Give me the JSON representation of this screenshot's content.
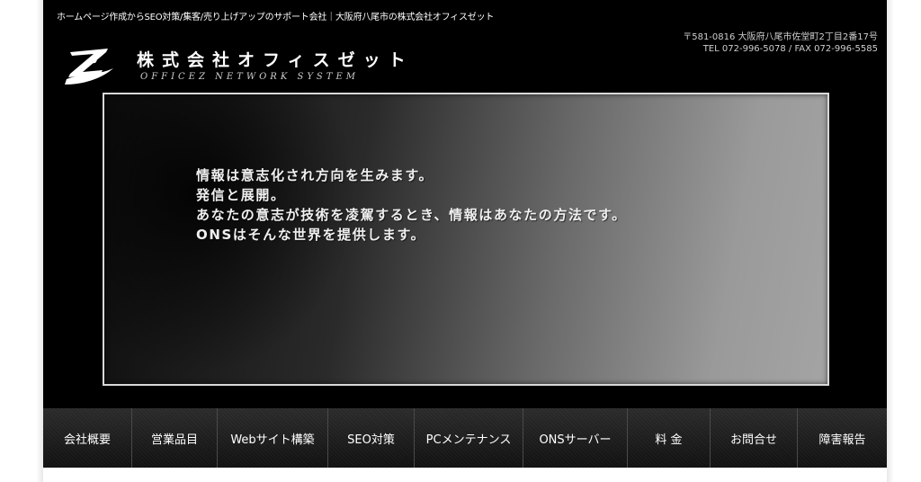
{
  "header": {
    "tagline": "ホームページ作成からSEO対策/集客/売り上げアップのサポート会社｜大阪府八尾市の株式会社オフィスゼット",
    "address_line1": "〒581-0816 大阪府八尾市佐堂町2丁目2番17号",
    "address_line2": "TEL 072-996-5078 / FAX 072-996-5585",
    "company_name": "株式会社オフィスゼット",
    "company_sub": "OFFICEZ NETWORK SYSTEM"
  },
  "hero": {
    "lines": [
      "情報は意志化され方向を生みます。",
      "発信と展開。",
      "あなたの意志が技術を凌駕するとき、情報はあなたの方法です。",
      "ONSはそんな世界を提供します。"
    ]
  },
  "nav": {
    "items": [
      {
        "label": "会社概要"
      },
      {
        "label": "営業品目"
      },
      {
        "label": "Webサイト構築"
      },
      {
        "label": "SEO対策"
      },
      {
        "label": "PCメンテナンス"
      },
      {
        "label": "ONSサーバー"
      },
      {
        "label": "料 金"
      },
      {
        "label": "お問合せ"
      },
      {
        "label": "障害報告"
      }
    ]
  }
}
